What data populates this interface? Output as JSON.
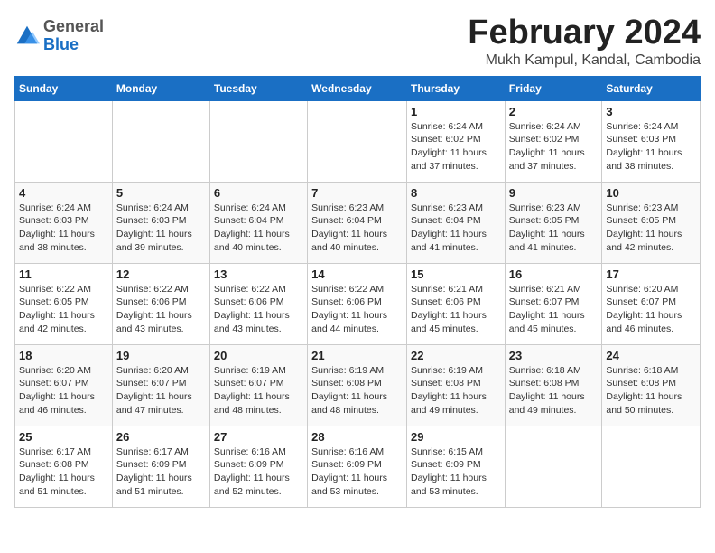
{
  "logo": {
    "general": "General",
    "blue": "Blue"
  },
  "title": "February 2024",
  "subtitle": "Mukh Kampul, Kandal, Cambodia",
  "headers": [
    "Sunday",
    "Monday",
    "Tuesday",
    "Wednesday",
    "Thursday",
    "Friday",
    "Saturday"
  ],
  "weeks": [
    [
      {
        "day": "",
        "detail": ""
      },
      {
        "day": "",
        "detail": ""
      },
      {
        "day": "",
        "detail": ""
      },
      {
        "day": "",
        "detail": ""
      },
      {
        "day": "1",
        "detail": "Sunrise: 6:24 AM\nSunset: 6:02 PM\nDaylight: 11 hours\nand 37 minutes."
      },
      {
        "day": "2",
        "detail": "Sunrise: 6:24 AM\nSunset: 6:02 PM\nDaylight: 11 hours\nand 37 minutes."
      },
      {
        "day": "3",
        "detail": "Sunrise: 6:24 AM\nSunset: 6:03 PM\nDaylight: 11 hours\nand 38 minutes."
      }
    ],
    [
      {
        "day": "4",
        "detail": "Sunrise: 6:24 AM\nSunset: 6:03 PM\nDaylight: 11 hours\nand 38 minutes."
      },
      {
        "day": "5",
        "detail": "Sunrise: 6:24 AM\nSunset: 6:03 PM\nDaylight: 11 hours\nand 39 minutes."
      },
      {
        "day": "6",
        "detail": "Sunrise: 6:24 AM\nSunset: 6:04 PM\nDaylight: 11 hours\nand 40 minutes."
      },
      {
        "day": "7",
        "detail": "Sunrise: 6:23 AM\nSunset: 6:04 PM\nDaylight: 11 hours\nand 40 minutes."
      },
      {
        "day": "8",
        "detail": "Sunrise: 6:23 AM\nSunset: 6:04 PM\nDaylight: 11 hours\nand 41 minutes."
      },
      {
        "day": "9",
        "detail": "Sunrise: 6:23 AM\nSunset: 6:05 PM\nDaylight: 11 hours\nand 41 minutes."
      },
      {
        "day": "10",
        "detail": "Sunrise: 6:23 AM\nSunset: 6:05 PM\nDaylight: 11 hours\nand 42 minutes."
      }
    ],
    [
      {
        "day": "11",
        "detail": "Sunrise: 6:22 AM\nSunset: 6:05 PM\nDaylight: 11 hours\nand 42 minutes."
      },
      {
        "day": "12",
        "detail": "Sunrise: 6:22 AM\nSunset: 6:06 PM\nDaylight: 11 hours\nand 43 minutes."
      },
      {
        "day": "13",
        "detail": "Sunrise: 6:22 AM\nSunset: 6:06 PM\nDaylight: 11 hours\nand 43 minutes."
      },
      {
        "day": "14",
        "detail": "Sunrise: 6:22 AM\nSunset: 6:06 PM\nDaylight: 11 hours\nand 44 minutes."
      },
      {
        "day": "15",
        "detail": "Sunrise: 6:21 AM\nSunset: 6:06 PM\nDaylight: 11 hours\nand 45 minutes."
      },
      {
        "day": "16",
        "detail": "Sunrise: 6:21 AM\nSunset: 6:07 PM\nDaylight: 11 hours\nand 45 minutes."
      },
      {
        "day": "17",
        "detail": "Sunrise: 6:20 AM\nSunset: 6:07 PM\nDaylight: 11 hours\nand 46 minutes."
      }
    ],
    [
      {
        "day": "18",
        "detail": "Sunrise: 6:20 AM\nSunset: 6:07 PM\nDaylight: 11 hours\nand 46 minutes."
      },
      {
        "day": "19",
        "detail": "Sunrise: 6:20 AM\nSunset: 6:07 PM\nDaylight: 11 hours\nand 47 minutes."
      },
      {
        "day": "20",
        "detail": "Sunrise: 6:19 AM\nSunset: 6:07 PM\nDaylight: 11 hours\nand 48 minutes."
      },
      {
        "day": "21",
        "detail": "Sunrise: 6:19 AM\nSunset: 6:08 PM\nDaylight: 11 hours\nand 48 minutes."
      },
      {
        "day": "22",
        "detail": "Sunrise: 6:19 AM\nSunset: 6:08 PM\nDaylight: 11 hours\nand 49 minutes."
      },
      {
        "day": "23",
        "detail": "Sunrise: 6:18 AM\nSunset: 6:08 PM\nDaylight: 11 hours\nand 49 minutes."
      },
      {
        "day": "24",
        "detail": "Sunrise: 6:18 AM\nSunset: 6:08 PM\nDaylight: 11 hours\nand 50 minutes."
      }
    ],
    [
      {
        "day": "25",
        "detail": "Sunrise: 6:17 AM\nSunset: 6:08 PM\nDaylight: 11 hours\nand 51 minutes."
      },
      {
        "day": "26",
        "detail": "Sunrise: 6:17 AM\nSunset: 6:09 PM\nDaylight: 11 hours\nand 51 minutes."
      },
      {
        "day": "27",
        "detail": "Sunrise: 6:16 AM\nSunset: 6:09 PM\nDaylight: 11 hours\nand 52 minutes."
      },
      {
        "day": "28",
        "detail": "Sunrise: 6:16 AM\nSunset: 6:09 PM\nDaylight: 11 hours\nand 53 minutes."
      },
      {
        "day": "29",
        "detail": "Sunrise: 6:15 AM\nSunset: 6:09 PM\nDaylight: 11 hours\nand 53 minutes."
      },
      {
        "day": "",
        "detail": ""
      },
      {
        "day": "",
        "detail": ""
      }
    ]
  ]
}
